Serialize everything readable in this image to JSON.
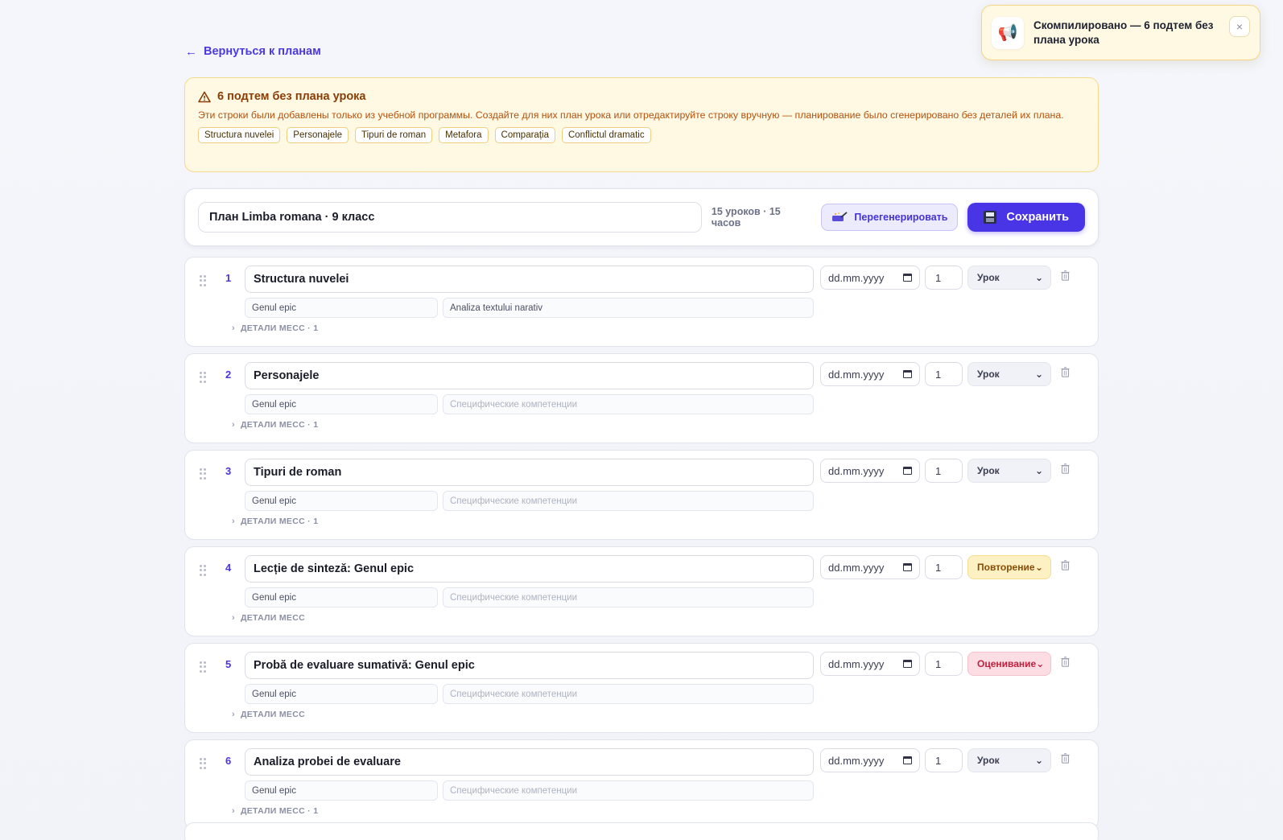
{
  "nav": {
    "back_label": "Вернуться к планам"
  },
  "warning": {
    "title": "6 подтем без плана урока",
    "text": "Эти строки были добавлены только из учебной программы. Создайте для них план урока или отредактируйте строку вручную — планирование было сгенерировано без деталей их плана.",
    "chips": [
      "Structura nuvelei",
      "Personajele",
      "Tipuri de roman",
      "Metafora",
      "Comparația",
      "Conflictul dramatic"
    ]
  },
  "plan": {
    "title": "План Limba romana · 9 класс",
    "stats": "15 уроков · 15 часов",
    "regen_label": "Перегенерировать",
    "save_label": "Сохранить"
  },
  "toast": {
    "text": "Скомпилировано — 6 подтем без плана урока",
    "close_label": "×"
  },
  "lessons": [
    {
      "num": "1",
      "title": "Structura nuvelei",
      "unit": "Genul epic",
      "competence": "Analiza textului narativ",
      "competence_is_placeholder": false,
      "details": "ДЕТАЛИ МЕСС · 1",
      "date_placeholder": "dd.mm.yyyy",
      "hours": "1",
      "type": "Урок",
      "type_kind": "lesson"
    },
    {
      "num": "2",
      "title": "Personajele",
      "unit": "Genul epic",
      "competence": "Специфические компетенции",
      "competence_is_placeholder": true,
      "details": "ДЕТАЛИ МЕСС · 1",
      "date_placeholder": "dd.mm.yyyy",
      "hours": "1",
      "type": "Урок",
      "type_kind": "lesson"
    },
    {
      "num": "3",
      "title": "Tipuri de roman",
      "unit": "Genul epic",
      "competence": "Специфические компетенции",
      "competence_is_placeholder": true,
      "details": "ДЕТАЛИ МЕСС · 1",
      "date_placeholder": "dd.mm.yyyy",
      "hours": "1",
      "type": "Урок",
      "type_kind": "lesson"
    },
    {
      "num": "4",
      "title": "Lecție de sinteză: Genul epic",
      "unit": "Genul epic",
      "competence": "Специфические компетенции",
      "competence_is_placeholder": true,
      "details": "ДЕТАЛИ МЕСС",
      "date_placeholder": "dd.mm.yyyy",
      "hours": "1",
      "type": "Повторение",
      "type_kind": "review"
    },
    {
      "num": "5",
      "title": "Probă de evaluare sumativă: Genul epic",
      "unit": "Genul epic",
      "competence": "Специфические компетенции",
      "competence_is_placeholder": true,
      "details": "ДЕТАЛИ МЕСС",
      "date_placeholder": "dd.mm.yyyy",
      "hours": "1",
      "type": "Оценивание",
      "type_kind": "eval"
    },
    {
      "num": "6",
      "title": "Analiza probei de evaluare",
      "unit": "Genul epic",
      "competence": "Специфические компетенции",
      "competence_is_placeholder": true,
      "details": "ДЕТАЛИ МЕСС · 1",
      "date_placeholder": "dd.mm.yyyy",
      "hours": "1",
      "type": "Урок",
      "type_kind": "lesson"
    }
  ],
  "icons": {
    "back": "arrow-left-icon",
    "warning": "warning-triangle-icon",
    "regen": "magic-wand-icon",
    "save": "floppy-disk-icon",
    "toast": "megaphone-icon",
    "drag": "drag-handle-icon",
    "calendar": "calendar-icon",
    "trash": "trash-icon"
  },
  "colors": {
    "accent": "#4a35e6",
    "warning_bg": "#fff8e2",
    "review_bg": "#fdf0c2",
    "eval_bg": "#fcdde4"
  }
}
